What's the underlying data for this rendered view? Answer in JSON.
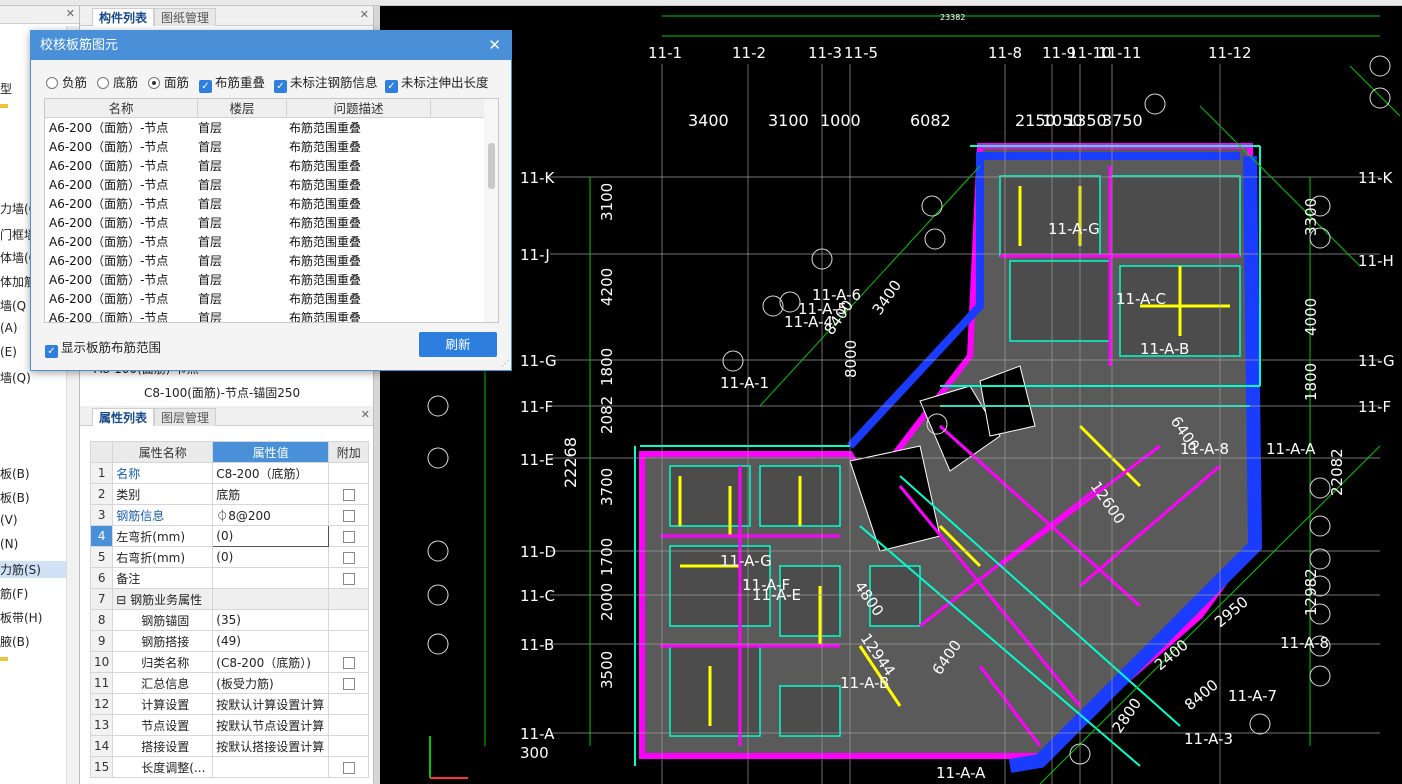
{
  "left_tree": {
    "items": [
      "型",
      "力墙(Q",
      "门框墙",
      "体墙(Q",
      "体加筋",
      "墙(Q",
      "(A)",
      "(E)",
      "墙(Q)",
      "板(B)",
      "板(B)",
      "(V)",
      "(N)",
      "力筋(S)",
      "筋(F)",
      "板带(H)",
      "腋(B)"
    ],
    "selected_index": 13
  },
  "component_panel": {
    "tabs": [
      "构件列表",
      "图纸管理"
    ],
    "rows": [
      "A8-100(面筋)-节点",
      "C8-100(面筋)-节点-锚固250"
    ]
  },
  "property_panel": {
    "tabs": [
      "属性列表",
      "图层管理"
    ],
    "headers": [
      "属性名称",
      "属性值",
      "附加"
    ],
    "rows": [
      {
        "no": "1",
        "name": "名称",
        "value": "C8-200（底筋）",
        "check": false,
        "blue": true
      },
      {
        "no": "2",
        "name": "类别",
        "value": "底筋",
        "check": true,
        "blue": false
      },
      {
        "no": "3",
        "name": "钢筋信息",
        "value": "⏀8@200",
        "check": true,
        "blue": true
      },
      {
        "no": "4",
        "name": "左弯折(mm)",
        "value": "(0)",
        "check": true,
        "blue": false
      },
      {
        "no": "5",
        "name": "右弯折(mm)",
        "value": "(0)",
        "check": true,
        "blue": false
      },
      {
        "no": "6",
        "name": "备注",
        "value": "",
        "check": true,
        "blue": false
      },
      {
        "no": "7",
        "name": "钢筋业务属性",
        "value": "",
        "check": false,
        "blue": false,
        "group": true
      },
      {
        "no": "8",
        "name": "钢筋锚固",
        "value": "(35)",
        "check": false,
        "blue": false
      },
      {
        "no": "9",
        "name": "钢筋搭接",
        "value": "(49)",
        "check": false,
        "blue": false
      },
      {
        "no": "10",
        "name": "归类名称",
        "value": "(C8-200（底筋）)",
        "check": true,
        "blue": false
      },
      {
        "no": "11",
        "name": "汇总信息",
        "value": "(板受力筋)",
        "check": true,
        "blue": false
      },
      {
        "no": "12",
        "name": "计算设置",
        "value": "按默认计算设置计算",
        "check": false,
        "blue": false
      },
      {
        "no": "13",
        "name": "节点设置",
        "value": "按默认节点设置计算",
        "check": false,
        "blue": false
      },
      {
        "no": "14",
        "name": "搭接设置",
        "value": "按默认搭接设置计算",
        "check": false,
        "blue": false
      },
      {
        "no": "15",
        "name": "长度调整(...",
        "value": "",
        "check": true,
        "blue": false
      }
    ]
  },
  "dialog": {
    "title": "校核板筋图元",
    "radios": [
      "负筋",
      "底筋",
      "面筋"
    ],
    "radio_selected": 2,
    "checks": [
      "布筋重叠",
      "未标注钢筋信息",
      "未标注伸出长度"
    ],
    "columns": [
      "名称",
      "楼层",
      "问题描述"
    ],
    "rows": [
      [
        "A6-200（面筋）-节点",
        "首层",
        "布筋范围重叠"
      ],
      [
        "A6-200（面筋）-节点",
        "首层",
        "布筋范围重叠"
      ],
      [
        "A6-200（面筋）-节点",
        "首层",
        "布筋范围重叠"
      ],
      [
        "A6-200（面筋）-节点",
        "首层",
        "布筋范围重叠"
      ],
      [
        "A6-200（面筋）-节点",
        "首层",
        "布筋范围重叠"
      ],
      [
        "A6-200（面筋）-节点",
        "首层",
        "布筋范围重叠"
      ],
      [
        "A6-200（面筋）-节点",
        "首层",
        "布筋范围重叠"
      ],
      [
        "A6-200（面筋）-节点",
        "首层",
        "布筋范围重叠"
      ],
      [
        "A6-200（面筋）-节点",
        "首层",
        "布筋范围重叠"
      ],
      [
        "A6-200（面筋）-节点",
        "首层",
        "布筋范围重叠"
      ],
      [
        "A6-200（面筋）-节点",
        "首层",
        "布筋范围重叠"
      ]
    ],
    "show_range_label": "显示板筋布筋范围",
    "refresh_label": "刷新"
  },
  "cad": {
    "top_total": "23382",
    "top_axes": [
      "11-1",
      "11-2",
      "11-3",
      "11-5",
      "11-8",
      "11-9",
      "11-10",
      "11-11",
      "11-12"
    ],
    "top_dims": [
      "3400",
      "3100",
      "1000",
      "6082",
      "2150",
      "1050",
      "1350",
      "3750"
    ],
    "left_axes": [
      "11-K",
      "11-J",
      "11-G",
      "11-F",
      "11-E",
      "11-D",
      "11-C",
      "11-B",
      "11-A"
    ],
    "left_dims": [
      "3100",
      "4200",
      "1800",
      "2082",
      "3700",
      "1700",
      "2000",
      "3500"
    ],
    "left_total": "22268",
    "right_axes": [
      "11-K",
      "11-H",
      "11-G",
      "11-F"
    ],
    "right_dims": [
      "3300",
      "4000",
      "1800",
      "12982"
    ],
    "right_total": "22082",
    "room_labels": [
      "11-A-G",
      "11-A-C",
      "11-A-B",
      "11-A-8",
      "11-A-6",
      "11-A-5",
      "11-A-4",
      "11-A-1",
      "11-A-G",
      "11-A-F",
      "11-A-E",
      "11-A-B",
      "11-A-A",
      "11-A-8",
      "11-A-7",
      "11-A-3",
      "11-A-A"
    ],
    "diag_dims": [
      "12600",
      "4800",
      "12944",
      "6400",
      "8400",
      "8000",
      "3400",
      "6400",
      "2950",
      "2400",
      "8400",
      "2800",
      "300"
    ],
    "colors": {
      "bg": "#000000",
      "axis": "#ffffff",
      "green": "#00c800",
      "magenta": "#ff00ff",
      "blue": "#1a3cff",
      "yellow": "#ffff00",
      "cyan": "#00ffcc",
      "slab": "#5a5a5a"
    }
  }
}
